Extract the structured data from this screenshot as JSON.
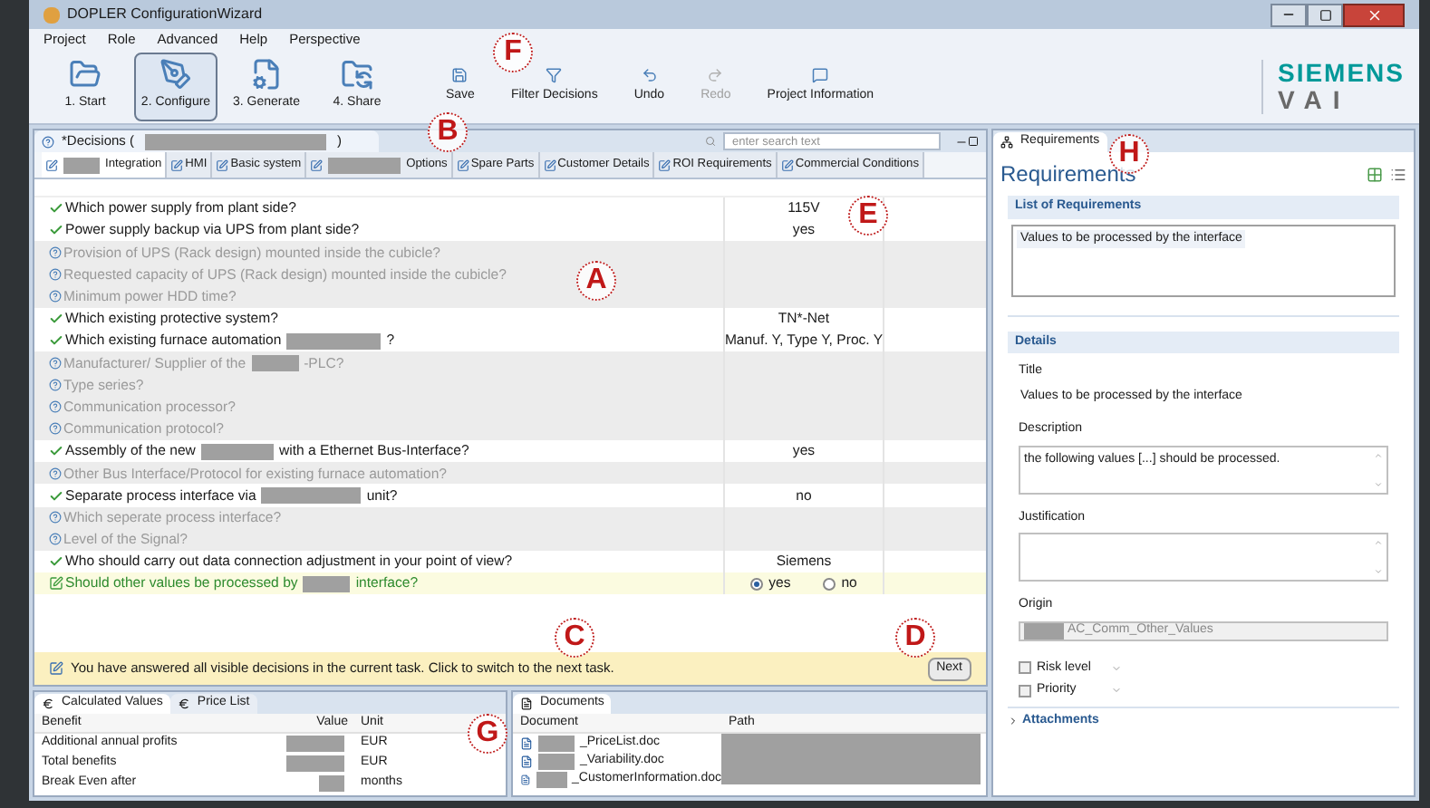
{
  "window": {
    "title": "DOPLER ConfigurationWizard"
  },
  "menu": [
    "Project",
    "Role",
    "Advanced",
    "Help",
    "Perspective"
  ],
  "steps": [
    {
      "label": "1. Start",
      "selected": false
    },
    {
      "label": "2. Configure",
      "selected": true
    },
    {
      "label": "3. Generate",
      "selected": false
    },
    {
      "label": "4. Share",
      "selected": false
    }
  ],
  "actions": [
    {
      "kind": "save",
      "label": "Save",
      "disabled": false
    },
    {
      "kind": "filter",
      "label": "Filter Decisions",
      "disabled": false
    },
    {
      "kind": "undo",
      "label": "Undo",
      "disabled": false
    },
    {
      "kind": "redo",
      "label": "Redo",
      "disabled": true
    },
    {
      "kind": "info",
      "label": "Project Information",
      "disabled": false
    }
  ],
  "logo": {
    "line_1": "SIEMENS",
    "line_2": "VAI"
  },
  "decisions": {
    "tab_parts": [
      "*Decisions (",
      ")"
    ],
    "search_placeholder": "enter search text",
    "tabs": [
      {
        "parts": [
          "Integration"
        ],
        "redacted_before": true,
        "selected": true
      },
      {
        "parts": [
          "HMI"
        ],
        "redacted_before": false,
        "selected": false
      },
      {
        "parts": [
          "Basic system"
        ],
        "redacted_before": false,
        "selected": false
      },
      {
        "parts": [
          "Options"
        ],
        "redacted_before": true,
        "selected": false
      },
      {
        "parts": [
          "Spare Parts"
        ],
        "redacted_before": false,
        "selected": false
      },
      {
        "parts": [
          "Customer Details"
        ],
        "redacted_before": false,
        "selected": false
      },
      {
        "parts": [
          "ROI Requirements"
        ],
        "redacted_before": false,
        "selected": false
      },
      {
        "parts": [
          "Commercial Conditions"
        ],
        "redacted_before": false,
        "selected": false
      }
    ],
    "questions": [
      {
        "kind": "answered",
        "parts": [
          "Which power supply from plant side?"
        ],
        "answer": "115V"
      },
      {
        "kind": "answered",
        "parts": [
          "Power supply backup via UPS from plant side?"
        ],
        "answer": "yes"
      },
      {
        "kind": "open",
        "parts": [
          "Provision of UPS (Rack design) mounted inside the cubicle?"
        ]
      },
      {
        "kind": "open",
        "parts": [
          "Requested capacity of UPS (Rack design) mounted inside the cubicle?"
        ]
      },
      {
        "kind": "open",
        "parts": [
          "Minimum power HDD time?"
        ]
      },
      {
        "kind": "answered",
        "parts": [
          "Which existing protective system?"
        ],
        "answer": "TN*-Net"
      },
      {
        "kind": "answered",
        "parts": [
          "Which existing furnace automation",
          "?"
        ],
        "answer": "Manuf. Y, Type Y, Proc. Y"
      },
      {
        "kind": "open",
        "parts": [
          "Manufacturer/ Supplier of the",
          "-PLC?"
        ]
      },
      {
        "kind": "open",
        "parts": [
          "Type series?"
        ]
      },
      {
        "kind": "open",
        "parts": [
          "Communication processor?"
        ]
      },
      {
        "kind": "open",
        "parts": [
          "Communication protocol?"
        ]
      },
      {
        "kind": "answered",
        "parts": [
          "Assembly of the new",
          "with a Ethernet Bus-Interface?"
        ],
        "answer": "yes"
      },
      {
        "kind": "open",
        "parts": [
          "Other Bus Interface/Protocol for existing furnace automation?"
        ]
      },
      {
        "kind": "answered",
        "parts": [
          "Separate process interface via",
          "unit?"
        ],
        "answer": "no"
      },
      {
        "kind": "open",
        "parts": [
          "Which seperate process interface?"
        ]
      },
      {
        "kind": "open",
        "parts": [
          "Level of the Signal?"
        ]
      },
      {
        "kind": "answered",
        "parts": [
          "Who should carry out data connection adjustment in your point of view?"
        ],
        "answer": "Siemens"
      },
      {
        "kind": "current",
        "parts": [
          "Should other values be processed by",
          "interface?"
        ],
        "options": [
          {
            "label": "yes",
            "selected": true
          },
          {
            "label": "no",
            "selected": false
          }
        ]
      }
    ],
    "hint": "You have answered all visible decisions in the current task. Click to switch to the next task.",
    "next": "Next"
  },
  "calculated": {
    "tabs": [
      {
        "label": "Calculated Values",
        "selected": true
      },
      {
        "label": "Price List",
        "selected": false
      }
    ],
    "columns": [
      "Benefit",
      "Value",
      "Unit"
    ],
    "rows": [
      {
        "benefit": "Additional annual profits",
        "unit": "EUR"
      },
      {
        "benefit": "Total benefits",
        "unit": "EUR"
      },
      {
        "benefit": "Break Even after",
        "unit": "months"
      }
    ]
  },
  "documents": {
    "tab": "Documents",
    "columns": [
      "Document",
      "Path"
    ],
    "rows": [
      "_PriceList.doc",
      "_Variability.doc",
      "_CustomerInformation.doc"
    ]
  },
  "requirements": {
    "tab": "Requirements",
    "heading": "Requirements",
    "list_section": "List of Requirements",
    "items": [
      "Values to be processed by the interface"
    ],
    "details_section": "Details",
    "title_label": "Title",
    "title_value": "Values to be processed by the interface",
    "description_label": "Description",
    "description": "the following values [...] should be processed.",
    "justification_label": "Justification",
    "origin_label": "Origin",
    "origin": "AC_Comm_Other_Values",
    "checks": [
      {
        "label": "Risk level",
        "checked": false
      },
      {
        "label": "Priority",
        "checked": false
      }
    ],
    "attachments": "Attachments"
  },
  "callouts": [
    "A",
    "B",
    "C",
    "D",
    "E",
    "F",
    "G",
    "H"
  ]
}
